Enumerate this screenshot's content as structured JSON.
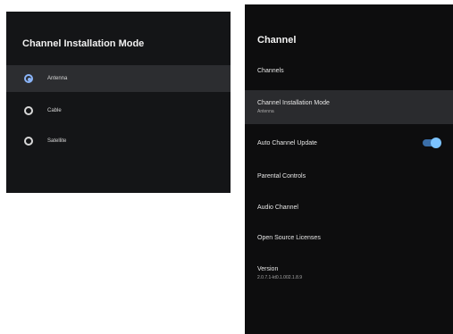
{
  "left_dialog": {
    "title": "Channel Installation Mode",
    "options": [
      {
        "label": "Antenna",
        "selected": true
      },
      {
        "label": "Cable",
        "selected": false
      },
      {
        "label": "Satellite",
        "selected": false
      }
    ]
  },
  "right_menu": {
    "title": "Channel",
    "items": [
      {
        "label": "Channels"
      },
      {
        "label": "Channel Installation Mode",
        "sub": "Antenna",
        "focused": true
      },
      {
        "label": "Auto Channel Update",
        "toggle": true,
        "toggle_on": true
      },
      {
        "label": "Parental Controls"
      },
      {
        "label": "Audio Channel"
      },
      {
        "label": "Open Source Licenses"
      },
      {
        "label": "Version",
        "sub": "2.0.7.1-kt0.1.002.1.8.9"
      }
    ]
  },
  "colors": {
    "accent": "#8ab4f8",
    "toggle_on": "#7cc3ff"
  }
}
